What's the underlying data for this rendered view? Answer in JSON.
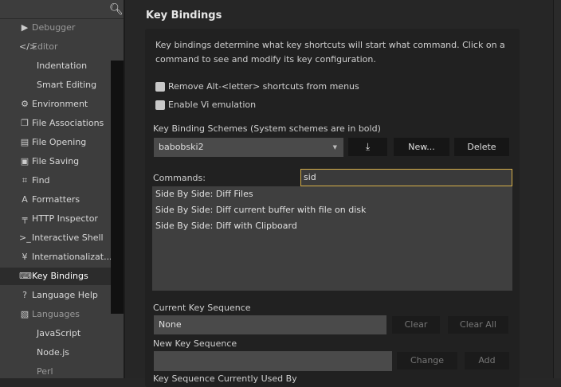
{
  "sidebar": {
    "search_icon": "search-icon",
    "items": [
      {
        "label": "Debugger",
        "icon": "▶",
        "dim": true
      },
      {
        "label": "Editor",
        "icon": "</>",
        "dim": true
      },
      {
        "label": "Indentation",
        "sub": true
      },
      {
        "label": "Smart Editing",
        "sub": true
      },
      {
        "label": "Environment",
        "icon": "⚙"
      },
      {
        "label": "File Associations",
        "icon": "❐"
      },
      {
        "label": "File Opening",
        "icon": "▤"
      },
      {
        "label": "File Saving",
        "icon": "▣"
      },
      {
        "label": "Find",
        "icon": "⌗"
      },
      {
        "label": "Formatters",
        "icon": "A"
      },
      {
        "label": "HTTP Inspector",
        "icon": "╤"
      },
      {
        "label": "Interactive Shell",
        "icon": ">_"
      },
      {
        "label": "Internationalizat...",
        "icon": "¥"
      },
      {
        "label": "Key Bindings",
        "icon": "⌨",
        "selected": true
      },
      {
        "label": "Language Help",
        "icon": "?"
      },
      {
        "label": "Languages",
        "icon": "▧",
        "dim": true
      },
      {
        "label": "JavaScript",
        "sub": true
      },
      {
        "label": "Node.js",
        "sub": true
      },
      {
        "label": "Perl",
        "sub": true,
        "dim": true
      }
    ]
  },
  "main": {
    "title": "Key Bindings",
    "desc1": "Key bindings determine what key shortcuts will start what command. Click on a",
    "desc2": "command to see and modify its key configuration.",
    "chk_alt": "Remove Alt-<letter> shortcuts from menus",
    "chk_vi": "Enable Vi emulation",
    "schemes_label": "Key Binding Schemes (System schemes are in bold)",
    "scheme_value": "babobski2",
    "new_btn": "New...",
    "delete_btn": "Delete",
    "commands_label": "Commands:",
    "filter_value": "sid",
    "commands": [
      "Side By Side: Diff Files",
      "Side By Side: Diff current buffer with file on disk",
      "Side By Side: Diff with Clipboard"
    ],
    "current_label": "Current Key Sequence",
    "current_value": "None",
    "clear_btn": "Clear",
    "clear_all_btn": "Clear All",
    "new_seq_label": "New Key Sequence",
    "change_btn": "Change",
    "add_btn": "Add",
    "used_by_label": "Key Sequence Currently Used By"
  },
  "colors": {
    "accent": "#d8b04a"
  }
}
